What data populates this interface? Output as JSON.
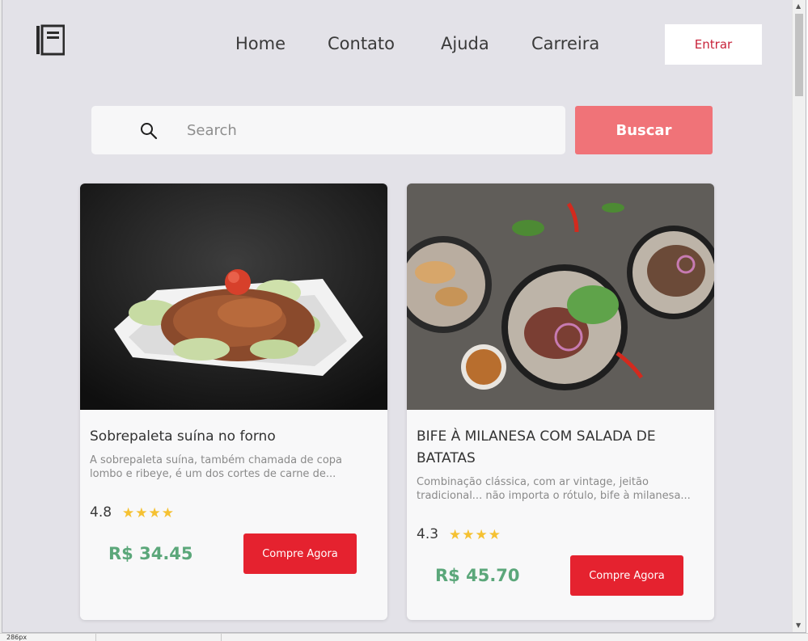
{
  "header": {
    "logo_icon": "book-icon",
    "nav": [
      {
        "label": "Home"
      },
      {
        "label": "Contato"
      },
      {
        "label": "Ajuda"
      },
      {
        "label": "Carreira"
      }
    ],
    "login_label": "Entrar"
  },
  "search": {
    "icon": "search-icon",
    "placeholder": "Search",
    "value": "",
    "button_label": "Buscar"
  },
  "products": [
    {
      "title": "Sobrepaleta suína no forno",
      "description": "A sobrepaleta suína, também chamada de copa lombo e ribeye, é um dos cortes de carne de...",
      "rating": "4.8",
      "stars": 4,
      "price": "R$ 34.45",
      "button_label": "Compre Agora"
    },
    {
      "title": "BIFE À MILANESA COM SALADA DE BATATAS",
      "description": "Combinação clássica, com ar vintage, jeitão tradicional... não importa o rótulo, bife à milanesa...",
      "rating": "4.3",
      "stars": 4,
      "price": "R$ 45.70",
      "button_label": "Compre Agora"
    }
  ],
  "status_bar": {
    "text": "286px"
  },
  "colors": {
    "accent": "#e5222f",
    "search_button": "#f07378",
    "price": "#5ba77a",
    "star": "#f5c132",
    "background": "#e3e2e8"
  }
}
